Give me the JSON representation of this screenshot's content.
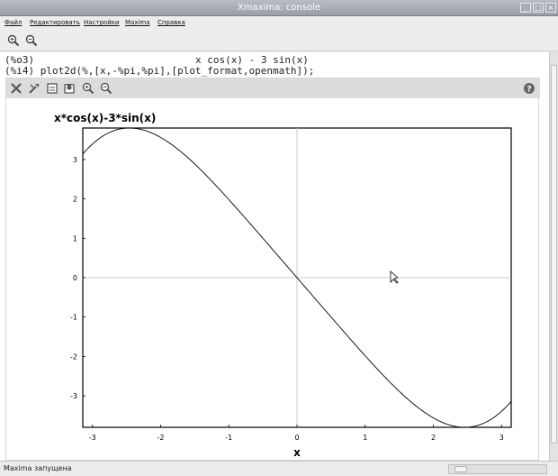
{
  "window": {
    "title": "Xmaxima: console"
  },
  "menubar": {
    "items": [
      "Файл",
      "Редактировать",
      "Настройки",
      "Maxima",
      "Справка"
    ]
  },
  "toolbar": {
    "icons": [
      "zoom-in-icon",
      "zoom-out-icon"
    ]
  },
  "console": {
    "output_label": "(%o3)",
    "output_expr": "x cos(x) - 3 sin(x)",
    "input_label": "(%i4)",
    "input_cmd": "plot2d(%,[x,-%pi,%pi],[plot_format,openmath]);"
  },
  "plot_toolbar": {
    "icons": [
      "close-icon",
      "config-icon",
      "replot-icon",
      "save-icon",
      "zoom-in-icon",
      "zoom-out-icon",
      "help-icon"
    ]
  },
  "chart_data": {
    "type": "line",
    "title": "x*cos(x)-3*sin(x)",
    "xlabel": "x",
    "ylabel": "",
    "function": "x*cos(x)-3*sin(x)",
    "xlim": [
      -3.1416,
      3.1416
    ],
    "ylim": [
      -3.8,
      3.8
    ],
    "xticks": [
      -3,
      -2,
      -1,
      0,
      1,
      2,
      3
    ],
    "yticks": [
      -3,
      -2,
      -1,
      0,
      1,
      2,
      3
    ],
    "grid": false,
    "axes_lines": true,
    "series": [
      {
        "name": "",
        "color": "#000000"
      }
    ]
  },
  "statusbar": {
    "text": "Maxima запущена"
  },
  "colors": {
    "titlebar": "#a4a9b0",
    "plot_toolbar": "#dcdcdc",
    "background": "#ffffff"
  }
}
